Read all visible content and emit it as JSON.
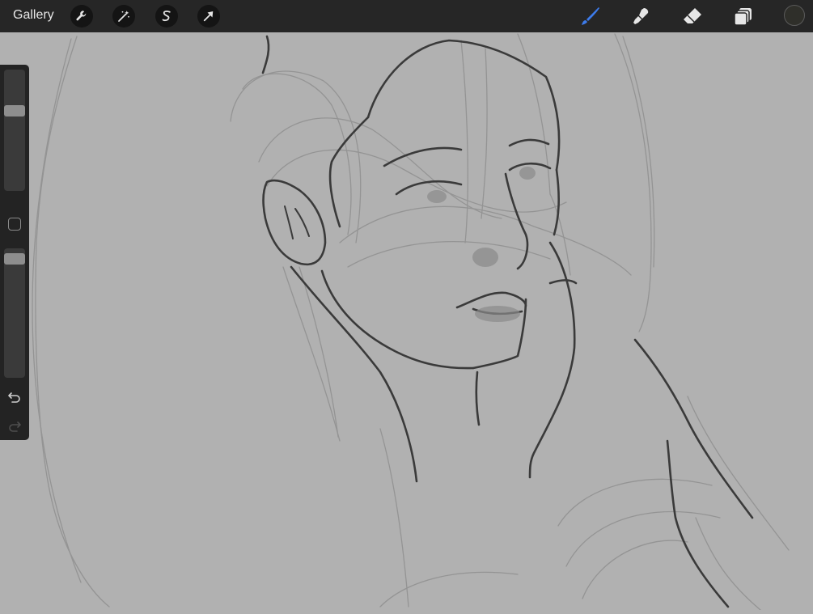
{
  "toolbar": {
    "gallery_label": "Gallery",
    "left_tools": [
      {
        "name": "actions",
        "icon": "wrench-icon"
      },
      {
        "name": "adjustments",
        "icon": "magic-wand-icon"
      },
      {
        "name": "selection",
        "icon": "selection-s-icon"
      },
      {
        "name": "transform",
        "icon": "arrow-cursor-icon"
      }
    ],
    "right_tools": [
      {
        "name": "brush",
        "icon": "brush-icon",
        "active": true
      },
      {
        "name": "smudge",
        "icon": "smudge-icon"
      },
      {
        "name": "eraser",
        "icon": "eraser-icon"
      },
      {
        "name": "layers",
        "icon": "layers-icon"
      }
    ],
    "current_color": "#2f2f2a"
  },
  "sidebar": {
    "brush_size_level": 0.68,
    "opacity_level": 0.97
  },
  "colors": {
    "accent": "#3d7bea",
    "canvas": "#b1b1b1",
    "toolbar": "#262626"
  }
}
